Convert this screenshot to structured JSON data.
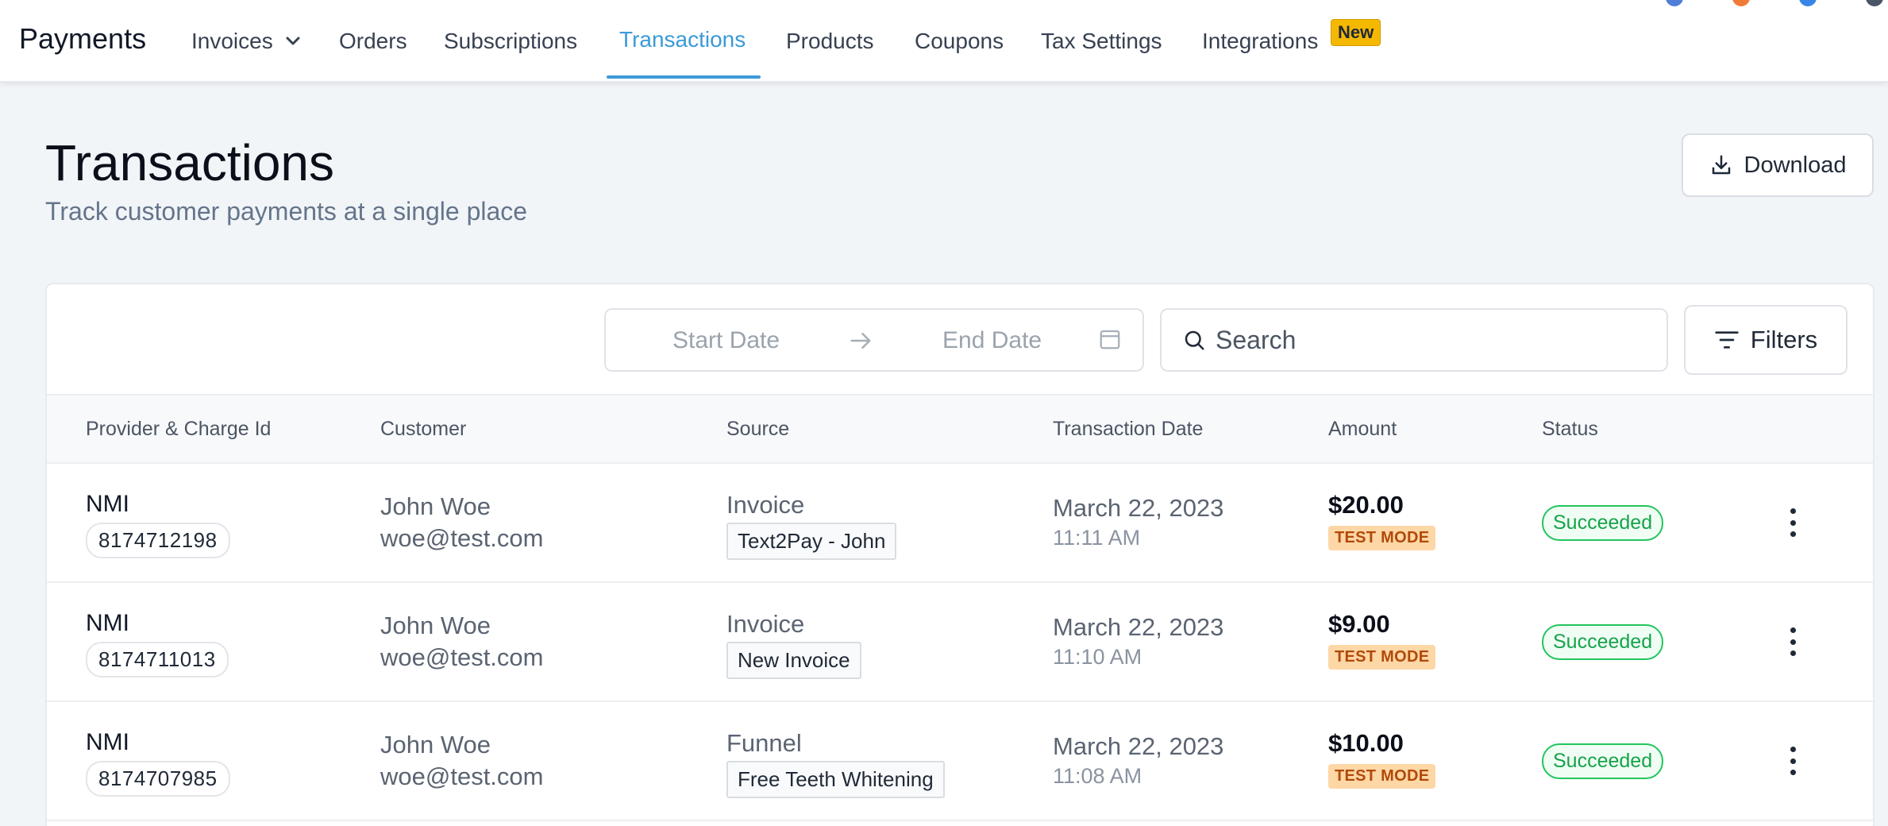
{
  "app": {
    "title": "Payments"
  },
  "nav": {
    "items": [
      {
        "label": "Invoices"
      },
      {
        "label": "Orders"
      },
      {
        "label": "Subscriptions"
      },
      {
        "label": "Transactions"
      },
      {
        "label": "Products"
      },
      {
        "label": "Coupons"
      },
      {
        "label": "Tax Settings"
      },
      {
        "label": "Integrations"
      }
    ],
    "active": "Transactions",
    "new_badge": "New"
  },
  "header": {
    "title": "Transactions",
    "subtitle": "Track customer payments at a single place",
    "download_label": "Download"
  },
  "toolbar": {
    "start_date_placeholder": "Start Date",
    "end_date_placeholder": "End Date",
    "search_placeholder": "Search",
    "filters_label": "Filters"
  },
  "table": {
    "columns": [
      "Provider & Charge Id",
      "Customer",
      "Source",
      "Transaction Date",
      "Amount",
      "Status"
    ],
    "rows": [
      {
        "provider": "NMI",
        "charge_id": "8174712198",
        "customer_name": "John Woe",
        "customer_email": "woe@test.com",
        "source_type": "Invoice",
        "source_name": "Text2Pay - John",
        "date": "March 22, 2023",
        "time": "11:11 AM",
        "amount": "$20.00",
        "mode": "TEST MODE",
        "status": "Succeeded"
      },
      {
        "provider": "NMI",
        "charge_id": "8174711013",
        "customer_name": "John Woe",
        "customer_email": "woe@test.com",
        "source_type": "Invoice",
        "source_name": "New Invoice",
        "date": "March 22, 2023",
        "time": "11:10 AM",
        "amount": "$9.00",
        "mode": "TEST MODE",
        "status": "Succeeded"
      },
      {
        "provider": "NMI",
        "charge_id": "8174707985",
        "customer_name": "John Woe",
        "customer_email": "woe@test.com",
        "source_type": "Funnel",
        "source_name": "Free Teeth Whitening",
        "date": "March 22, 2023",
        "time": "11:08 AM",
        "amount": "$10.00",
        "mode": "TEST MODE",
        "status": "Succeeded"
      }
    ]
  },
  "colors": {
    "accent": "#3b9ad9",
    "new_badge": "#f5b800",
    "success": "#16a34a",
    "test_mode_bg": "#fed7a6",
    "page_bg": "#f1f5f8"
  }
}
